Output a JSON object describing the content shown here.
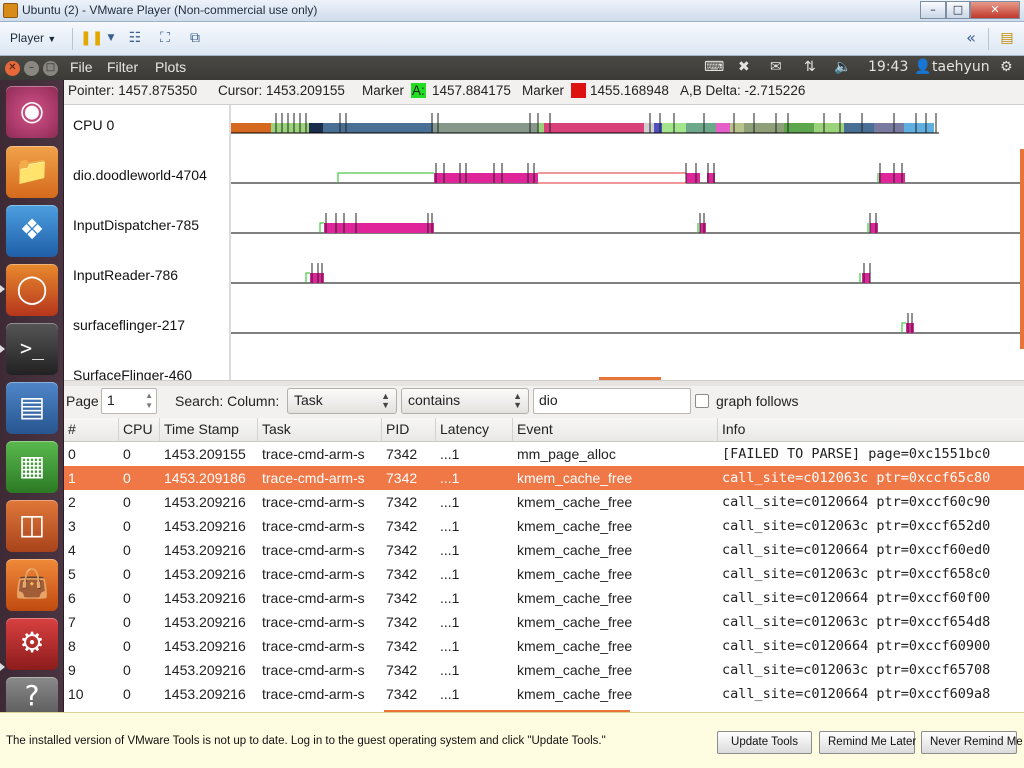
{
  "vmware": {
    "title": "Ubuntu (2) - VMware Player (Non-commercial use only)",
    "player_label": "Player"
  },
  "panel": {
    "menus": [
      "File",
      "Filter",
      "Plots"
    ],
    "time": "19:43",
    "user": "taehyun"
  },
  "info": {
    "pointer": "Pointer: 1457.875350",
    "cursor": "Cursor: 1453.209155",
    "marker_a_label": "Marker",
    "marker_a_tag": "A:",
    "marker_a_value": "1457.884175",
    "marker_b_label": "Marker",
    "marker_b_tag": "B:",
    "marker_b_value": "1455.168948",
    "delta": "A,B Delta: -2.715226",
    "marker_a_color": "#22dd22",
    "marker_b_color": "#dd1111"
  },
  "plots": {
    "labels": [
      "CPU 0",
      "dio.doodleworld-4704",
      "InputDispatcher-785",
      "InputReader-786",
      "surfaceflinger-217",
      "SurfaceFlinger-460"
    ],
    "task_color": "#e0259a",
    "wake_color": "#22bb22",
    "wait_color": "#e03030"
  },
  "search": {
    "page_label": "Page",
    "page_value": "1",
    "search_label": "Search: Column:",
    "column": "Task",
    "op": "contains",
    "term": "dio",
    "graph_follows_label": "graph follows"
  },
  "table": {
    "columns": [
      "#",
      "CPU",
      "Time Stamp",
      "Task",
      "PID",
      "Latency",
      "Event",
      "Info"
    ],
    "rows": [
      [
        "0",
        "0",
        "1453.209155",
        "trace-cmd-arm-s",
        "7342",
        "...1",
        "mm_page_alloc",
        "[FAILED TO PARSE] page=0xc1551bc0"
      ],
      [
        "1",
        "0",
        "1453.209186",
        "trace-cmd-arm-s",
        "7342",
        "...1",
        "kmem_cache_free",
        "call_site=c012063c ptr=0xccf65c80"
      ],
      [
        "2",
        "0",
        "1453.209216",
        "trace-cmd-arm-s",
        "7342",
        "...1",
        "kmem_cache_free",
        "call_site=c0120664 ptr=0xccf60c90"
      ],
      [
        "3",
        "0",
        "1453.209216",
        "trace-cmd-arm-s",
        "7342",
        "...1",
        "kmem_cache_free",
        "call_site=c012063c ptr=0xccf652d0"
      ],
      [
        "4",
        "0",
        "1453.209216",
        "trace-cmd-arm-s",
        "7342",
        "...1",
        "kmem_cache_free",
        "call_site=c0120664 ptr=0xccf60ed0"
      ],
      [
        "5",
        "0",
        "1453.209216",
        "trace-cmd-arm-s",
        "7342",
        "...1",
        "kmem_cache_free",
        "call_site=c012063c ptr=0xccf658c0"
      ],
      [
        "6",
        "0",
        "1453.209216",
        "trace-cmd-arm-s",
        "7342",
        "...1",
        "kmem_cache_free",
        "call_site=c0120664 ptr=0xccf60f00"
      ],
      [
        "7",
        "0",
        "1453.209216",
        "trace-cmd-arm-s",
        "7342",
        "...1",
        "kmem_cache_free",
        "call_site=c012063c ptr=0xccf654d8"
      ],
      [
        "8",
        "0",
        "1453.209216",
        "trace-cmd-arm-s",
        "7342",
        "...1",
        "kmem_cache_free",
        "call_site=c0120664 ptr=0xccf60900"
      ],
      [
        "9",
        "0",
        "1453.209216",
        "trace-cmd-arm-s",
        "7342",
        "...1",
        "kmem_cache_free",
        "call_site=c012063c ptr=0xccf65708"
      ],
      [
        "10",
        "0",
        "1453.209216",
        "trace-cmd-arm-s",
        "7342",
        "...1",
        "kmem_cache_free",
        "call_site=c0120664 ptr=0xccf609a8"
      ]
    ],
    "selected_row": 1,
    "selected_color": "#f07746"
  },
  "notification": {
    "message": "The installed version of VMware Tools is not up to date. Log in to the guest operating system and click \"Update Tools.\"",
    "update_label": "Update Tools",
    "remind_label": "Remind Me Later",
    "never_label": "Never Remind Me"
  }
}
